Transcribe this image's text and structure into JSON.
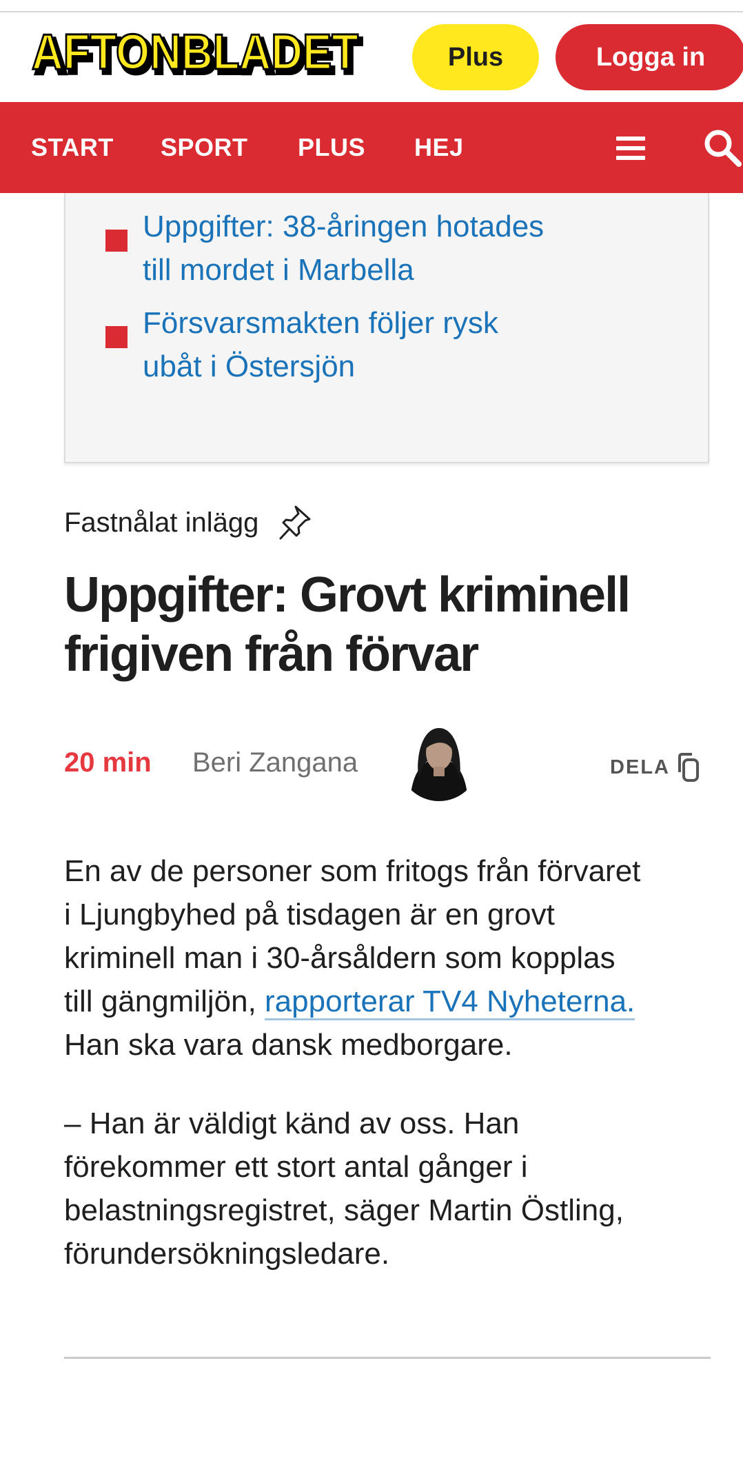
{
  "header": {
    "logo_text": "AFTONBLADET",
    "plus_label": "Plus",
    "login_label": "Logga in"
  },
  "nav": {
    "items": [
      "START",
      "SPORT",
      "PLUS",
      "HEJ"
    ],
    "menu_icon": "hamburger-menu-icon",
    "search_icon": "search-icon"
  },
  "related": {
    "items": [
      {
        "line1": "Uppgifter: 38-åringen hotades",
        "line2": "till mordet i Marbella"
      },
      {
        "line1": "Försvarsmakten följer rysk",
        "line2": "ubåt i Östersjön"
      }
    ]
  },
  "article": {
    "pinned_label": "Fastnålat inlägg",
    "pinned_icon": "pushpin-icon",
    "headline_line1": "Uppgifter: Grovt kriminell",
    "headline_line2": "frigiven från förvar",
    "time": "20 min",
    "author": "Beri Zangana",
    "share_label": "DELA",
    "share_icon": "copy-icon",
    "p1": {
      "l1": "En av de personer som fritogs från förvaret",
      "l2": "i Ljungbyhed på tisdagen är en grovt",
      "l3": "kriminell man i 30-årsåldern som kopplas",
      "l4_pre": "till gängmiljön, ",
      "link": "rapporterar TV4 Nyheterna.",
      "l5": "Han ska vara dansk medborgare."
    },
    "p2": {
      "l1": "– Han är väldigt känd av oss. Han",
      "l2": "förekommer ett stort antal gånger i",
      "l3": "belastningsregistret, säger Martin Östling,",
      "l4": "förundersökningsledare."
    }
  },
  "colors": {
    "brand_red": "#db2b32",
    "plus_yellow": "#ffe81e",
    "link_blue": "#1a73b8",
    "time_red": "#e5393f"
  }
}
